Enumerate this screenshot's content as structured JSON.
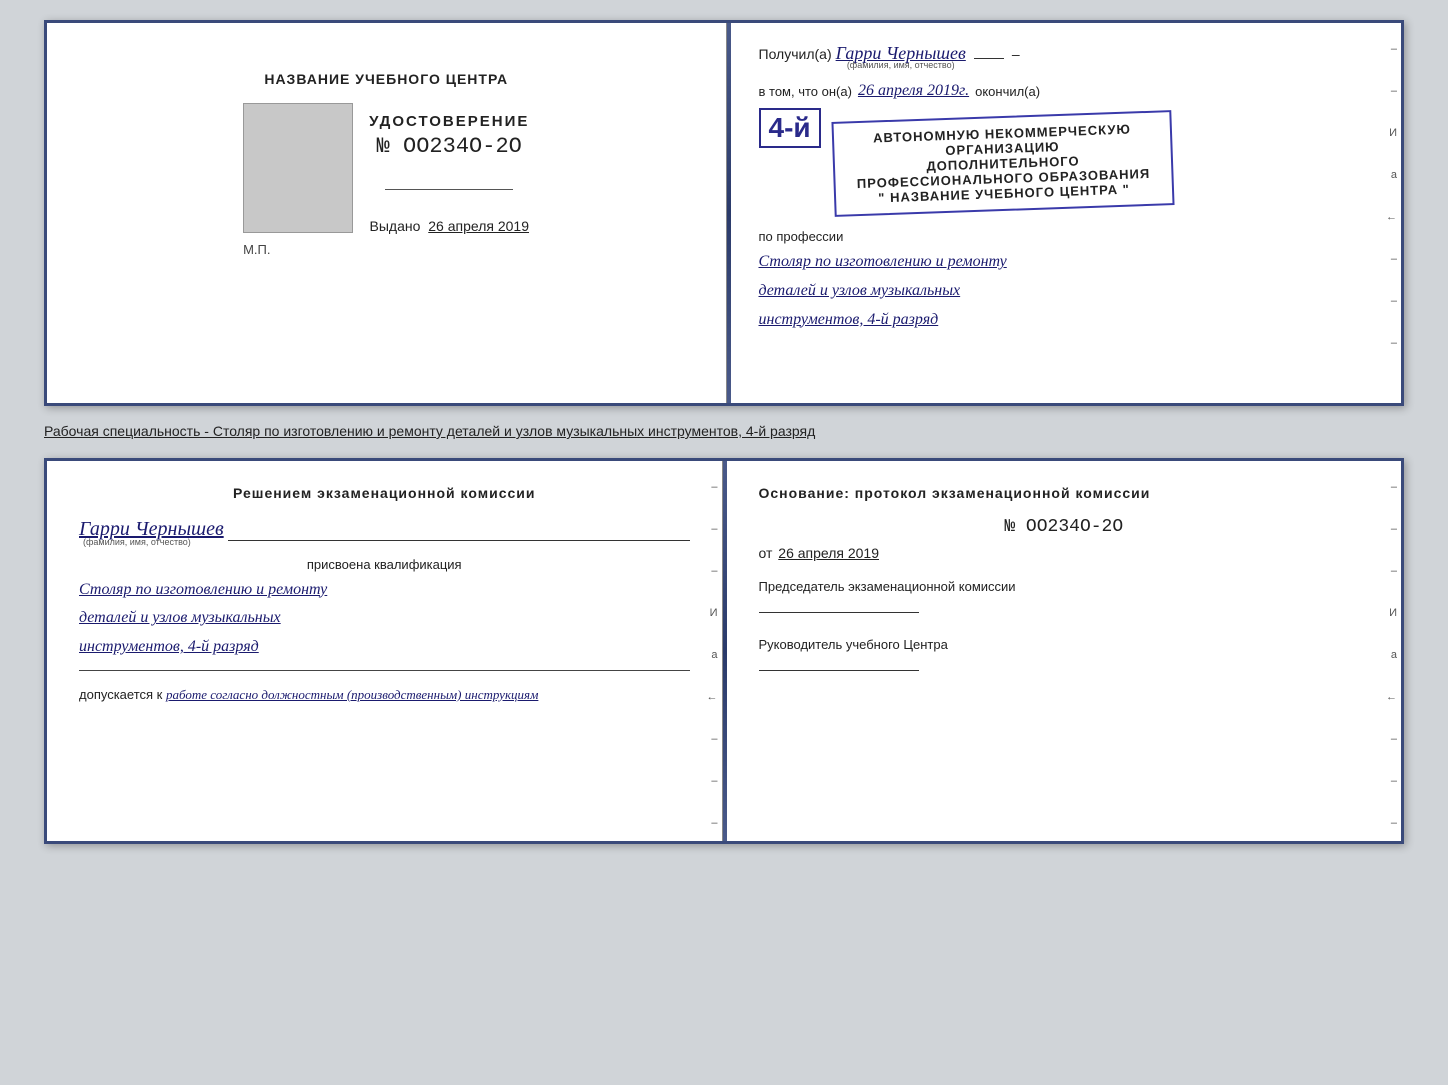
{
  "top_document": {
    "left": {
      "center_title": "НАЗВАНИЕ УЧЕБНОГО ЦЕНТРА",
      "cert_label": "УДОСТОВЕРЕНИЕ",
      "cert_number": "№ OO234O-2O",
      "issued_label": "Выдано",
      "issued_date": "26 апреля 2019",
      "mp": "М.П."
    },
    "right": {
      "received_prefix": "Получил(а)",
      "name_handwritten": "Гарри Чернышев",
      "name_sublabel": "(фамилия, имя, отчество)",
      "dash": "–",
      "vtom_prefix": "в том, что он(а)",
      "date_handwritten": "26 апреля 2019г.",
      "completed": "окончил(а)",
      "year_badge": "4-й",
      "stamp_line1": "АВТОНОМНУЮ НЕКОММЕРЧЕСКУЮ ОРГАНИЗАЦИЮ",
      "stamp_line2": "ДОПОЛНИТЕЛЬНОГО ПРОФЕССИОНАЛЬНОГО ОБРАЗОВАНИЯ",
      "stamp_line3": "\" НАЗВАНИЕ УЧЕБНОГО ЦЕНТРА \"",
      "profession_label": "по профессии",
      "profession_line1": "Столяр по изготовлению и ремонту",
      "profession_line2": "деталей и узлов музыкальных",
      "profession_line3": "инструментов, 4-й разряд"
    }
  },
  "caption": {
    "text": "Рабочая специальность - Столяр по изготовлению и ремонту деталей и узлов музыкальных инструментов, 4-й разряд"
  },
  "bottom_document": {
    "left": {
      "title": "Решением  экзаменационной  комиссии",
      "name_handwritten": "Гарри Чернышев",
      "name_sublabel": "(фамилия, имя, отчество)",
      "qualification_label": "присвоена квалификация",
      "profession_line1": "Столяр по изготовлению и ремонту",
      "profession_line2": "деталей и узлов музыкальных",
      "profession_line3": "инструментов, 4-й разряд",
      "allowed_prefix": "допускается к",
      "allowed_value": "работе согласно должностным (производственным) инструкциям"
    },
    "right": {
      "basis_title": "Основание: протокол  экзаменационной  комиссии",
      "protocol_number": "№  OO234O-2O",
      "date_prefix": "от",
      "date": "26 апреля 2019",
      "chairman_label": "Председатель экзаменационной комиссии",
      "director_label": "Руководитель учебного Центра"
    }
  },
  "side_labels": {
    "И": "И",
    "а": "а",
    "arrow": "←"
  }
}
